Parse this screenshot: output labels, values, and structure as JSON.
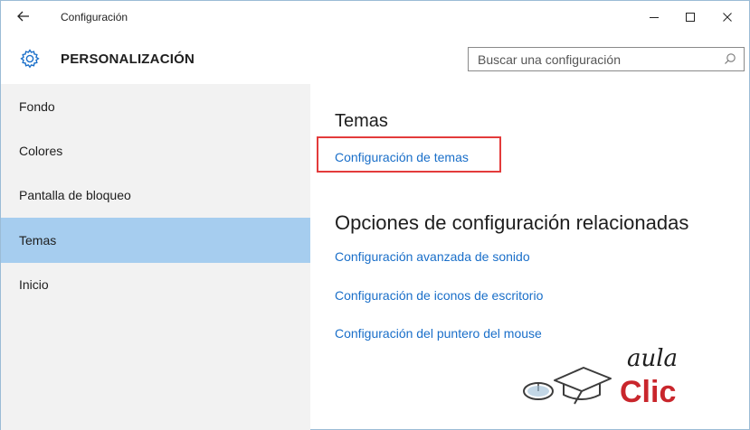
{
  "titlebar": {
    "back_icon": "back-arrow-icon",
    "title": "Configuración",
    "minimize_glyph": "—",
    "maximize_glyph": "☐",
    "close_glyph": "✕"
  },
  "header": {
    "icon": "gear-icon",
    "title": "PERSONALIZACIÓN",
    "search_placeholder": "Buscar una configuración",
    "search_icon": "search-icon"
  },
  "sidebar": {
    "items": [
      {
        "label": "Fondo",
        "active": false
      },
      {
        "label": "Colores",
        "active": false
      },
      {
        "label": "Pantalla de bloqueo",
        "active": false
      },
      {
        "label": "Temas",
        "active": true
      },
      {
        "label": "Inicio",
        "active": false
      }
    ]
  },
  "main": {
    "themes_heading": "Temas",
    "themes_link": "Configuración de temas",
    "related_heading": "Opciones de configuración relacionadas",
    "related_links": [
      "Configuración avanzada de sonido",
      "Configuración de iconos de escritorio",
      "Configuración del puntero del mouse"
    ]
  },
  "logo": {
    "word1": "aula",
    "word2": "Clic"
  },
  "colors": {
    "accent": "#1a6fc9",
    "sidebar_bg": "#f2f2f2",
    "active_item_bg": "#a6cdef",
    "highlight_border": "#e33b3b",
    "logo_red": "#c9262c"
  }
}
